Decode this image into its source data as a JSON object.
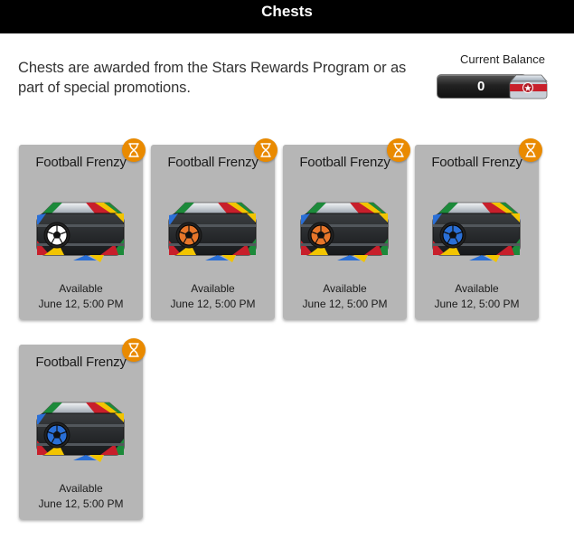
{
  "window": {
    "title": "Chests"
  },
  "intro": {
    "text": "Chests are awarded from the Stars Rewards Program or as part of special promotions."
  },
  "balance": {
    "label": "Current Balance",
    "value": "0"
  },
  "colors": {
    "card_bg": "#b6b6b6",
    "timer_badge": "#e98a00",
    "titlebar": "#000000"
  },
  "chests": [
    {
      "title": "Football Frenzy",
      "status": "Available",
      "date": "June 12, 5:00 PM",
      "ball_color": "#ffffff",
      "icon": "hourglass-icon"
    },
    {
      "title": "Football Frenzy",
      "status": "Available",
      "date": "June 12, 5:00 PM",
      "ball_color": "#e8762a",
      "icon": "hourglass-icon"
    },
    {
      "title": "Football Frenzy",
      "status": "Available",
      "date": "June 12, 5:00 PM",
      "ball_color": "#e8762a",
      "icon": "hourglass-icon"
    },
    {
      "title": "Football Frenzy",
      "status": "Available",
      "date": "June 12, 5:00 PM",
      "ball_color": "#2a6fd6",
      "icon": "hourglass-icon"
    },
    {
      "title": "Football Frenzy",
      "status": "Available",
      "date": "June 12, 5:00 PM",
      "ball_color": "#2a6fd6",
      "icon": "hourglass-icon"
    }
  ]
}
